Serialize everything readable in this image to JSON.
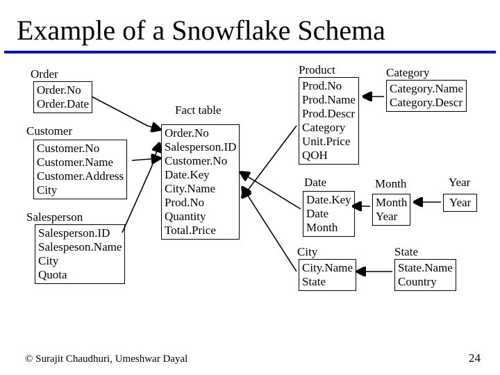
{
  "title": "Example of  a Snowflake Schema",
  "fact_label": "Fact table",
  "fact": [
    "Order.No",
    "Salesperson.ID",
    "Customer.No",
    "Date.Key",
    "City.Name",
    "Prod.No",
    "Quantity",
    "Total.Price"
  ],
  "order_label": "Order",
  "order": [
    "Order.No",
    "Order.Date"
  ],
  "customer_label": "Customer",
  "customer": [
    "Customer.No",
    "Customer.Name",
    "Customer.Address",
    "City"
  ],
  "salesperson_label": "Salesperson",
  "salesperson": [
    "Salesperson.ID",
    "Salespeson.Name",
    "City",
    "Quota"
  ],
  "product_label": "Product",
  "product": [
    "Prod.No",
    "Prod.Name",
    "Prod.Descr",
    "Category",
    "Unit.Price",
    "QOH"
  ],
  "category_label": "Category",
  "category": [
    "Category.Name",
    "Category.Descr"
  ],
  "date_label": "Date",
  "date": [
    "Date.Key",
    "Date",
    "Month"
  ],
  "month_label": "Month",
  "month": [
    "Month",
    "Year"
  ],
  "year_label": "Year",
  "year": [
    "Year"
  ],
  "city_label": "City",
  "city": [
    "City.Name",
    "State"
  ],
  "state_label": "State",
  "state": [
    "State.Name",
    "Country"
  ],
  "footer_left": "© Surajit Chaudhuri, Umeshwar Dayal",
  "footer_right": "24"
}
